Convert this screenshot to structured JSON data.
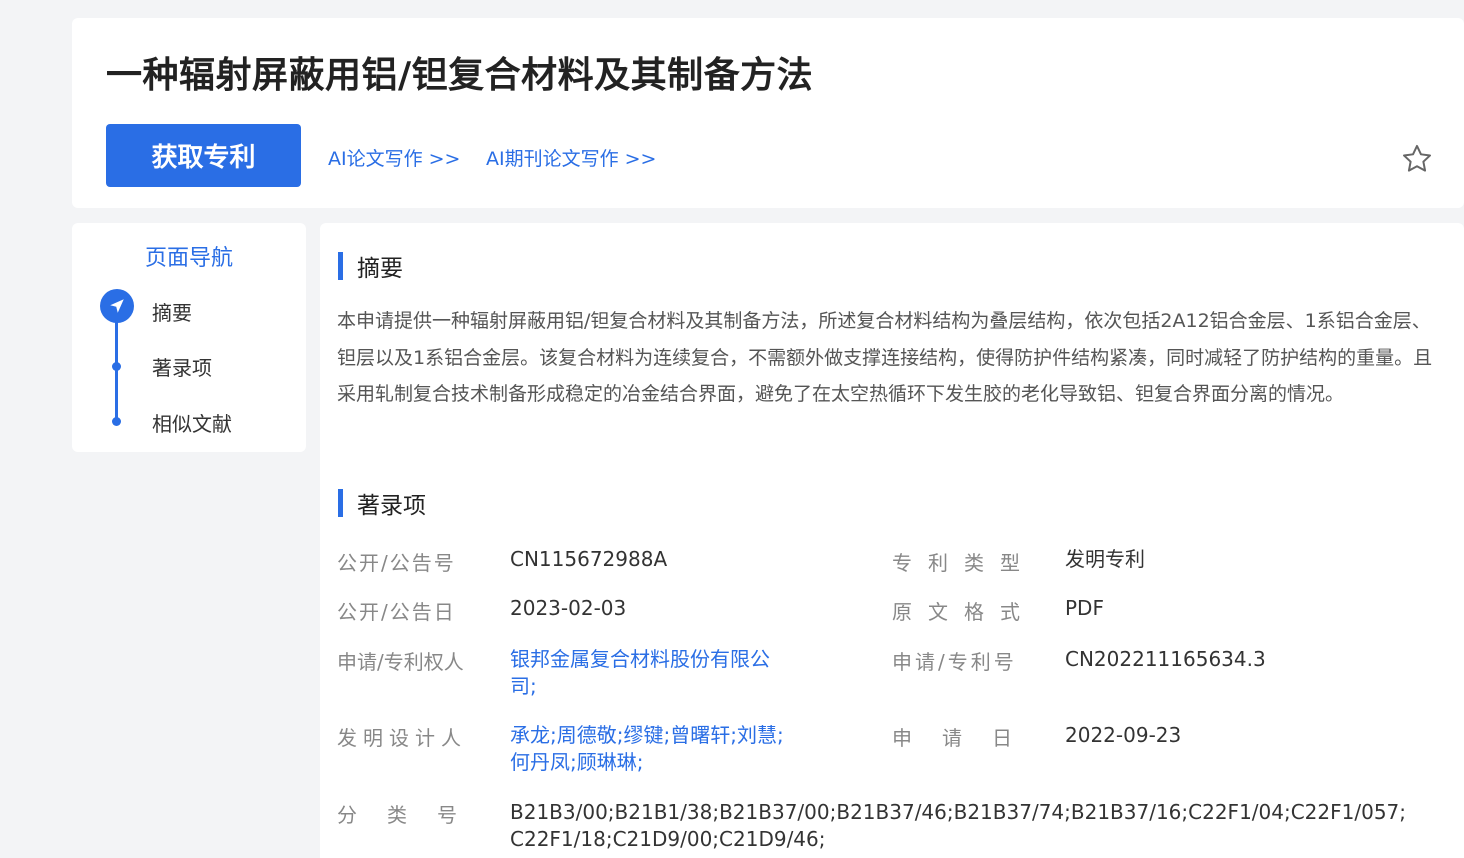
{
  "header": {
    "title": "一种辐射屏蔽用铝/钽复合材料及其制备方法",
    "get_patent_label": "获取专利",
    "link_paper": "AI论文写作 >>",
    "link_journal": "AI期刊论文写作 >>",
    "favorite_icon": "star-outline"
  },
  "nav": {
    "title": "页面导航",
    "items": [
      {
        "label": "摘要",
        "active": true
      },
      {
        "label": "著录项",
        "active": false
      },
      {
        "label": "相似文献",
        "active": false
      }
    ]
  },
  "abstract": {
    "heading": "摘要",
    "text": "本申请提供一种辐射屏蔽用铝/钽复合材料及其制备方法，所述复合材料结构为叠层结构，依次包括2A12铝合金层、1系铝合金层、钽层以及1系铝合金层。该复合材料为连续复合，不需额外做支撑连接结构，使得防护件结构紧凑，同时减轻了防护结构的重量。且采用轧制复合技术制备形成稳定的冶金结合界面，避免了在太空热循环下发生胶的老化导致铝、钽复合界面分离的情况。"
  },
  "bibliography": {
    "heading": "著录项",
    "publication_no_label": "公开/公告号",
    "publication_no": "CN115672988A",
    "patent_type_label": "专利类型",
    "patent_type": "发明专利",
    "publication_date_label": "公开/公告日",
    "publication_date": "2023-02-03",
    "format_label": "原文格式",
    "format": "PDF",
    "applicant_label": "申请/专利权人",
    "applicant": "银邦金属复合材料股份有限公司;",
    "application_no_label": "申请/专利号",
    "application_no": "CN202211165634.3",
    "inventors_label": "发明设计人",
    "inventors": "承龙;周德敬;缪键;曾曙轩;刘慧;何丹凤;顾琳琳;",
    "application_date_label": "申请日",
    "application_date": "2022-09-23",
    "classification_label": "分类号",
    "classification": "B21B3/00;B21B1/38;B21B37/00;B21B37/46;B21B37/74;B21B37/16;C22F1/04;C22F1/057;C22F1/18;C21D9/00;C21D9/46;"
  },
  "colors": {
    "accent": "#2a6ee5",
    "background": "#f3f4f6"
  }
}
